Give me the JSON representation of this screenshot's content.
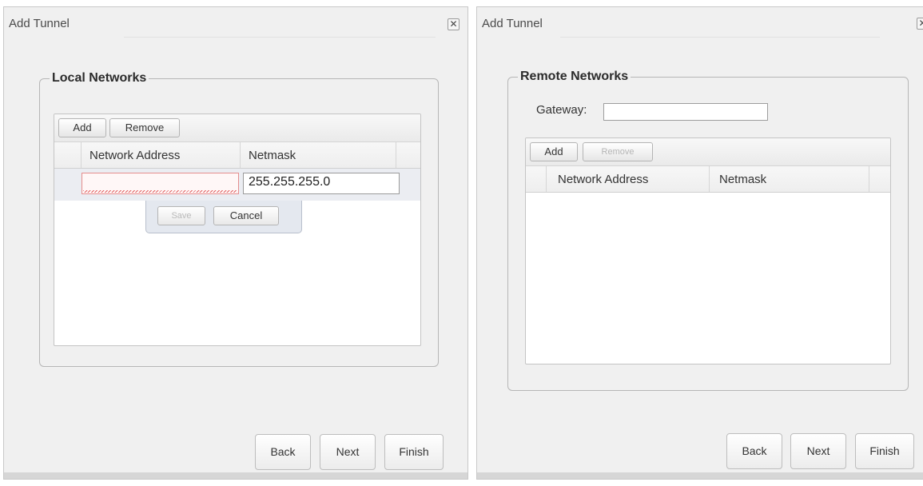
{
  "dialogs": [
    {
      "title": "Add Tunnel",
      "close_glyph": "✕",
      "group_title": "Local Networks",
      "toolbar": {
        "add_label": "Add",
        "remove_label": "Remove"
      },
      "columns": [
        "Network Address",
        "Netmask"
      ],
      "editor": {
        "network_address_value": "",
        "netmask_value": "255.255.255.0",
        "save_label": "Save",
        "cancel_label": "Cancel",
        "save_enabled": false
      },
      "footer": {
        "back_label": "Back",
        "next_label": "Next",
        "finish_label": "Finish"
      }
    },
    {
      "title": "Add Tunnel",
      "close_glyph": "✕",
      "group_title": "Remote Networks",
      "gateway_label": "Gateway:",
      "gateway_value": "",
      "toolbar": {
        "add_label": "Add",
        "remove_label": "Remove",
        "remove_enabled": false
      },
      "columns": [
        "Network Address",
        "Netmask"
      ],
      "footer": {
        "back_label": "Back",
        "next_label": "Next",
        "finish_label": "Finish"
      }
    }
  ],
  "colors": {
    "dialog_bg": "#f0f0f0",
    "invalid_border": "#e58d8d",
    "editor_bg": "#e4e8ef"
  },
  "icons": {
    "close": "close-icon"
  }
}
